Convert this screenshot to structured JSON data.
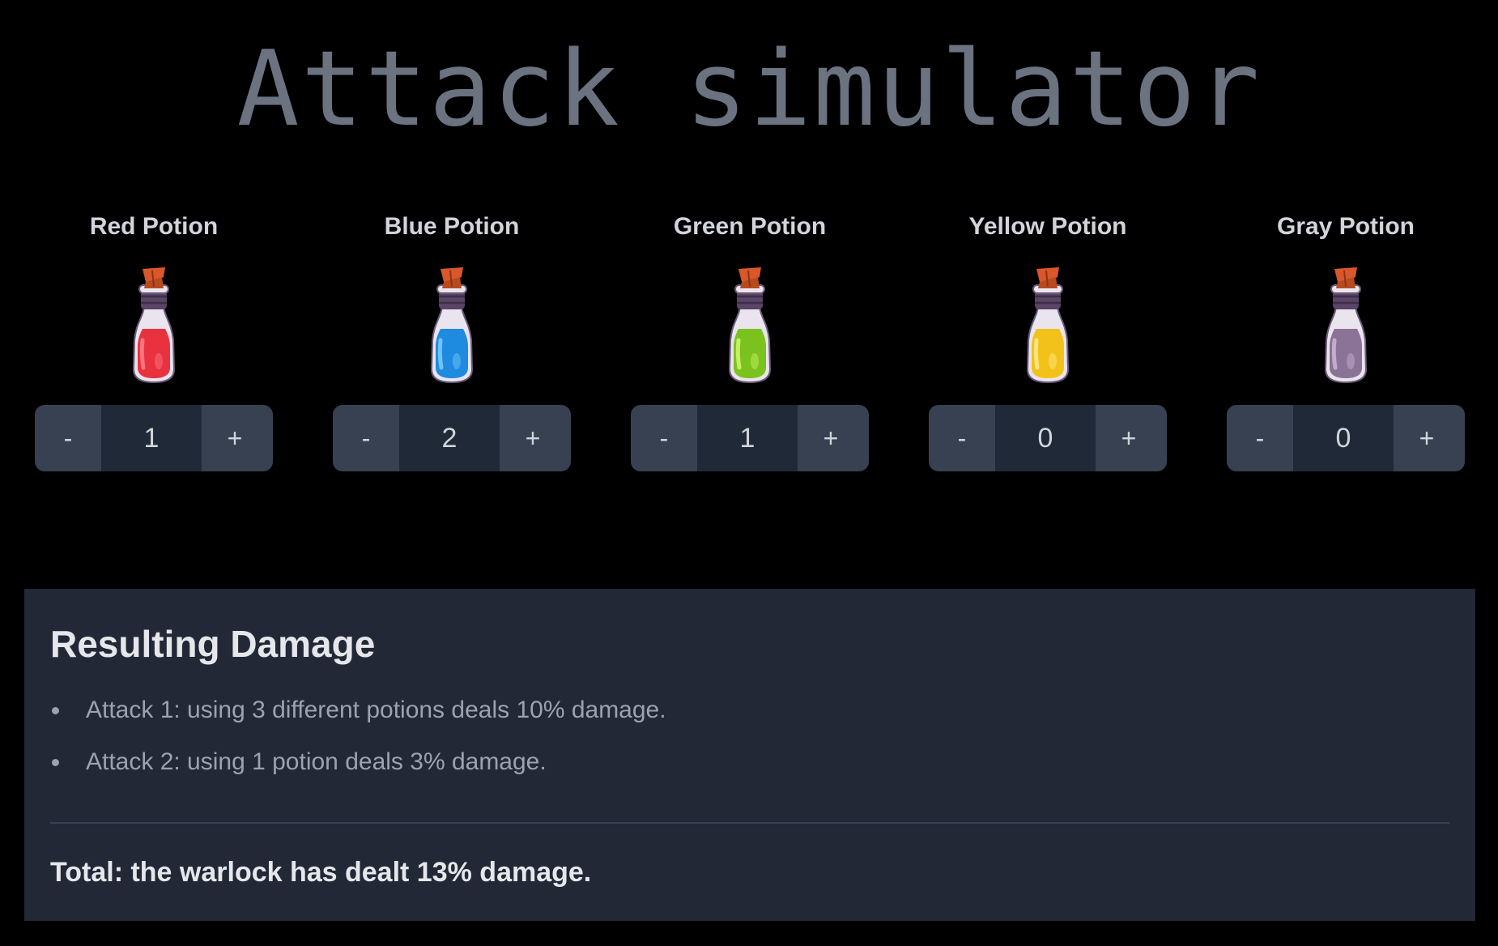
{
  "title": "Attack simulator",
  "potions": [
    {
      "name": "Red Potion",
      "count": "1",
      "color": "#e8323f",
      "highlight": "#ff7b86"
    },
    {
      "name": "Blue Potion",
      "count": "2",
      "color": "#1e8be0",
      "highlight": "#7cc8ff"
    },
    {
      "name": "Green Potion",
      "count": "1",
      "color": "#7cc21e",
      "highlight": "#cdf56a"
    },
    {
      "name": "Yellow Potion",
      "count": "0",
      "color": "#f2c21a",
      "highlight": "#ffe98a"
    },
    {
      "name": "Gray Potion",
      "count": "0",
      "color": "#8a7396",
      "highlight": "#c9b4d4"
    }
  ],
  "stepper": {
    "minus_label": "-",
    "plus_label": "+"
  },
  "results": {
    "title": "Resulting Damage",
    "attacks": [
      "Attack 1: using 3 different potions deals 10% damage.",
      "Attack 2: using 1 potion deals 3% damage."
    ],
    "total": "Total: the warlock has dealt 13% damage."
  }
}
